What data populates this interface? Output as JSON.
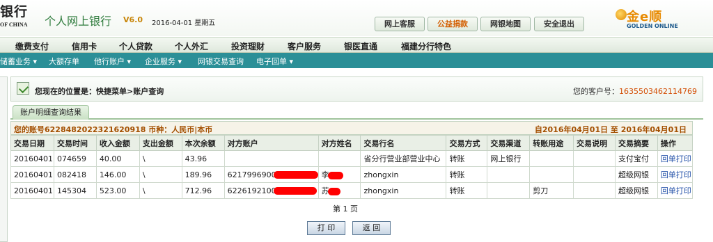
{
  "brand": {
    "logo_cn": "银行",
    "logo_en": "OF CHINA",
    "app_title": "个人网上银行",
    "version": "V6.0",
    "date": "2016-04-01 星期五",
    "partner_logo": "金e顺",
    "partner_sub": "GOLDEN ONLINE"
  },
  "top_buttons": [
    {
      "label": "网上客服"
    },
    {
      "label": "公益捐款"
    },
    {
      "label": "网银地图"
    },
    {
      "label": "安全退出"
    }
  ],
  "main_nav": [
    "缴费支付",
    "信用卡",
    "个人贷款",
    "个人外汇",
    "投资理财",
    "客户服务",
    "银医直通",
    "福建分行特色"
  ],
  "sub_nav": [
    "储蓄业务 ▾",
    "大额存单",
    "他行账户 ▾",
    "企业服务 ▾",
    "网银交易查询",
    "电子回单 ▾"
  ],
  "breadcrumb": {
    "text": "您现在的位置是：快捷菜单>账户查询",
    "customer_label": "您的客户号：",
    "customer_no": "1635503462114769"
  },
  "tab": {
    "label": "账户明细查询结果"
  },
  "account": {
    "info": "您的账号6228482022321620918 币种：人民币|本币",
    "range": "自2016年04月01日  至  2016年04月01日"
  },
  "table": {
    "headers": [
      "交易日期",
      "交易时间",
      "收入金额",
      "支出金额",
      "本次余额",
      "对方账户",
      "对方姓名",
      "交易行名",
      "交易方式",
      "交易渠道",
      "转账用途",
      "交易说明",
      "交易摘要",
      "操作"
    ],
    "rows": [
      {
        "date": "20160401",
        "time": "074659",
        "income": "40.00",
        "expense": "\\",
        "balance": "43.96",
        "account": "",
        "name": "",
        "bank": "省分行营业部营业中心",
        "method": "转账",
        "channel": "网上银行",
        "purpose": "",
        "note": "",
        "summary": "支付宝付",
        "action": "回单打印"
      },
      {
        "date": "20160401",
        "time": "082418",
        "income": "146.00",
        "expense": "\\",
        "balance": "189.96",
        "account": "6217996900",
        "name": "李",
        "bank": "zhongxin",
        "method": "转账",
        "channel": "",
        "purpose": "",
        "note": "",
        "summary": "超级网银",
        "action": "回单打印"
      },
      {
        "date": "20160401",
        "time": "145304",
        "income": "523.00",
        "expense": "\\",
        "balance": "712.96",
        "account": "6226192100",
        "name": "苏",
        "bank": "zhongxin",
        "method": "转账",
        "channel": "",
        "purpose": "剪刀",
        "note": "",
        "summary": "超级网银",
        "action": "回单打印"
      }
    ]
  },
  "pager": "第 1 页",
  "buttons": {
    "print": "打 印",
    "back": "返 回"
  },
  "colors": {
    "accent_teal": "#2b8f97",
    "customer_no": "#d34b00",
    "account_text": "#a34f00",
    "link": "#2250a8",
    "redaction": "#ff0000"
  }
}
